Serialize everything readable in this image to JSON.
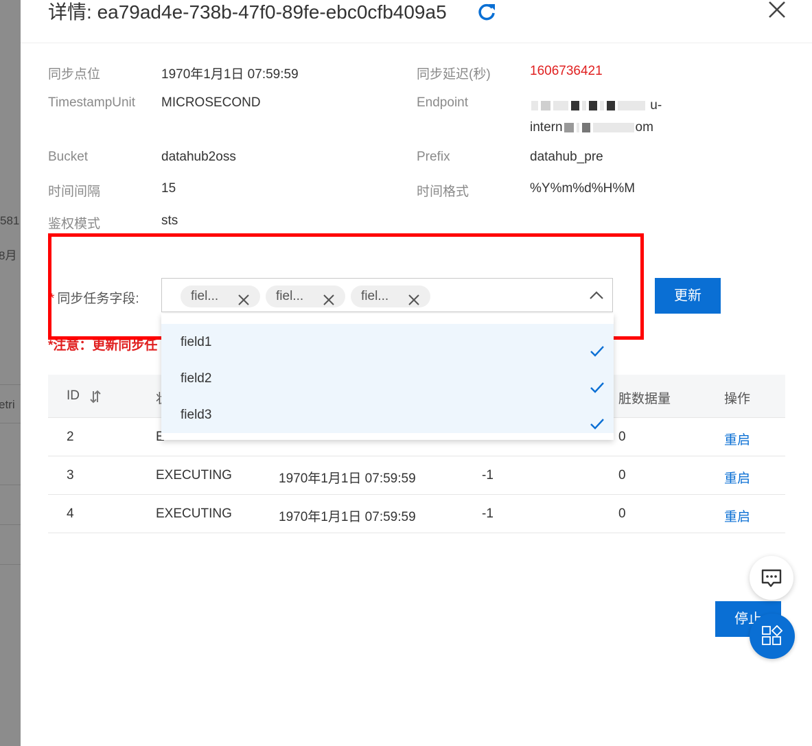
{
  "background_page": {
    "text_fragments": [
      "581",
      "8月",
      "etri"
    ]
  },
  "header": {
    "title_prefix": "详情: ",
    "task_id": "ea79ad4e-738b-47f0-89fe-ebc0cfb409a5"
  },
  "info": {
    "sync_point": {
      "label": "同步点位",
      "value": "1970年1月1日 07:59:59"
    },
    "sync_delay": {
      "label": "同步延迟(秒)",
      "value": "1606736421"
    },
    "timestamp_unit": {
      "label": "TimestampUnit",
      "value": "MICROSECOND"
    },
    "endpoint": {
      "label": "Endpoint",
      "value_part1": "u-",
      "value_part2": "intern",
      "value_part3": "om"
    },
    "bucket": {
      "label": "Bucket",
      "value": "datahub2oss"
    },
    "prefix": {
      "label": "Prefix",
      "value": "datahub_pre"
    },
    "time_interval": {
      "label": "时间间隔",
      "value": "15"
    },
    "time_format": {
      "label": "时间格式",
      "value": "%Y%m%d%H%M"
    },
    "auth_mode": {
      "label": "鉴权模式",
      "value": "sts"
    }
  },
  "sync_fields": {
    "required_mark": "*",
    "label": "同步任务字段:",
    "tags": [
      "fiel...",
      "fiel...",
      "fiel..."
    ],
    "update_label": "更新",
    "notice": "*注意：更新同步任",
    "options": [
      {
        "label": "field1",
        "selected": true
      },
      {
        "label": "field2",
        "selected": true
      },
      {
        "label": "field3",
        "selected": true
      }
    ]
  },
  "table": {
    "headers": {
      "id": "ID",
      "status": "状",
      "dirty": "脏数据量",
      "action": "操作"
    },
    "rows": [
      {
        "id": "2",
        "status": "E",
        "time": "",
        "delay": "",
        "dirty": "0",
        "action": "重启"
      },
      {
        "id": "3",
        "status": "EXECUTING",
        "time": "1970年1月1日 07:59:59",
        "delay": "-1",
        "dirty": "0",
        "action": "重启"
      },
      {
        "id": "4",
        "status": "EXECUTING",
        "time": "1970年1月1日 07:59:59",
        "delay": "-1",
        "dirty": "0",
        "action": "重启"
      }
    ]
  },
  "footer": {
    "stop_label": "停止"
  },
  "colors": {
    "primary": "#0a6fd4",
    "danger": "#e02020",
    "highlight": "#ff0000"
  },
  "icons": [
    "refresh-icon",
    "close-icon",
    "tag-close-icon",
    "chevron-up-icon",
    "check-icon",
    "sort-icon",
    "chat-icon",
    "apps-icon"
  ]
}
